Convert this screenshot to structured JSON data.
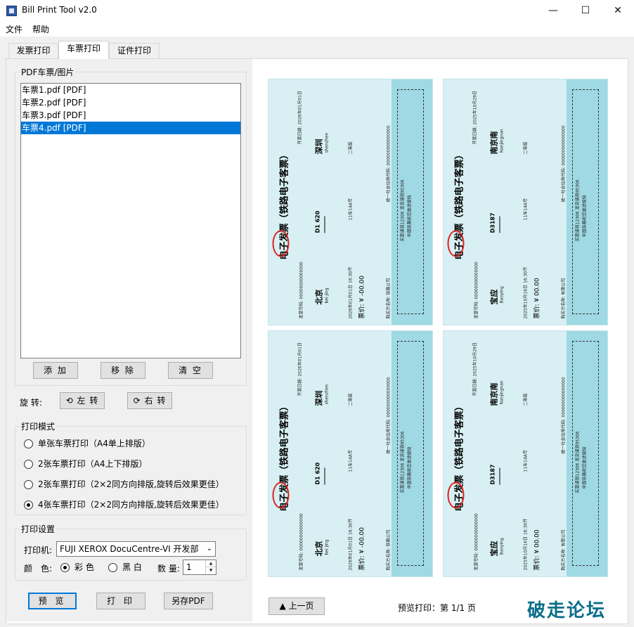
{
  "window": {
    "title": "Bill Print Tool v2.0"
  },
  "menu": {
    "items": [
      "文件",
      "帮助"
    ]
  },
  "tabs": [
    {
      "label": "发票打印"
    },
    {
      "label": "车票打印"
    },
    {
      "label": "证件打印"
    }
  ],
  "files_group": {
    "title": "PDF车票/图片",
    "items": [
      "车票1.pdf [PDF]",
      "车票2.pdf [PDF]",
      "车票3.pdf [PDF]",
      "车票4.pdf [PDF]"
    ],
    "selected_index": 3
  },
  "file_buttons": {
    "add": "添 加",
    "remove": "移 除",
    "clear": "清 空"
  },
  "rotate": {
    "label": "旋 转:",
    "left": "⟲ 左 转",
    "right": "⟳ 右 转"
  },
  "print_mode": {
    "title": "打印模式",
    "options": [
      "单张车票打印（A4单上排版）",
      "2张车票打印（A4上下排版）",
      "2张车票打印（2×2同方向排版,旋转后效果更佳）",
      "4张车票打印（2×2同方向排版,旋转后效果更佳）"
    ],
    "selected_index": 3
  },
  "print_settings": {
    "title": "打印设置",
    "printer_label": "打印机:",
    "printer_value": "FUJI XEROX DocuCentre-VI 开发部",
    "color_label": "颜　色:",
    "color_option": "彩 色",
    "bw_option": "黑 白",
    "count_label": "数 量:",
    "count_value": "1"
  },
  "actions": {
    "preview": "预 览",
    "print": "打 印",
    "save_pdf": "另存PDF"
  },
  "pager": {
    "prev": "▲ 上一页",
    "info": "预览打印：第 1/1 页"
  },
  "watermark": "破走论坛",
  "tickets": [
    {
      "title": "电子发票（铁路电子客票）",
      "date": "开票日期: 2026年01月01日",
      "invoice_no": "发票号码: 00000000000000",
      "from": "北京",
      "from_pinyin": "bei jing",
      "to": "深圳",
      "to_pinyin": "shenzhen",
      "station_suffix": "站",
      "train": "D1 620",
      "depart": "2026年01月01日  16:30开",
      "seat": "11车14A号",
      "class": "二等座",
      "price": "票价: ¥ -00.00",
      "stub1": "买票请到12306 发货请到95306",
      "stub2": "中国铁路祝您旅途愉快",
      "buyer": "购买方名称: 铁路公司",
      "credit": "统一社会信用代码: 000000000000000"
    },
    {
      "title": "电子发票（铁路电子客票）",
      "date": "开票日期: 2025年10月29日",
      "invoice_no": "发票号码: 00000000000000",
      "from": "宝应",
      "from_pinyin": "Baoying",
      "to": "南京南",
      "to_pinyin": "Nanjingnan",
      "station_suffix": "站",
      "train": "D3187",
      "depart": "2025年10月16日  16:30开",
      "seat": "11车14A号",
      "class": "二等座",
      "price": "票价: ¥ 00.00",
      "stub1": "买票请到12306 发货请到95306",
      "stub2": "中国铁路祝您旅途愉快",
      "buyer": "购买方名称: 有限公司",
      "credit": "统一社会信用代码: 000000000000000"
    },
    {
      "title": "电子发票（铁路电子客票）",
      "date": "开票日期: 2026年01月01日",
      "invoice_no": "发票号码: 00000000000000",
      "from": "北京",
      "from_pinyin": "bei jing",
      "to": "深圳",
      "to_pinyin": "shenzhen",
      "station_suffix": "站",
      "train": "D1 620",
      "depart": "2026年01月01日  16:30开",
      "seat": "11车14A号",
      "class": "二等座",
      "price": "票价: ¥ -00.00",
      "stub1": "买票请到12306 发货请到95306",
      "stub2": "中国铁路祝您旅途愉快",
      "buyer": "购买方名称: 铁路公司",
      "credit": "统一社会信用代码: 000000000000000"
    },
    {
      "title": "电子发票（铁路电子客票）",
      "date": "开票日期: 2025年10月29日",
      "invoice_no": "发票号码: 00000000000000",
      "from": "宝应",
      "from_pinyin": "Baoying",
      "to": "南京南",
      "to_pinyin": "Nanjingnan",
      "station_suffix": "站",
      "train": "D3187",
      "depart": "2025年10月16日  16:30开",
      "seat": "11车14A号",
      "class": "二等座",
      "price": "票价: ¥ 00.00",
      "stub1": "买票请到12306 发货请到95306",
      "stub2": "中国铁路祝您旅途愉快",
      "buyer": "购买方名称: 有限公司",
      "credit": "统一社会信用代码: 000000000000000"
    }
  ]
}
